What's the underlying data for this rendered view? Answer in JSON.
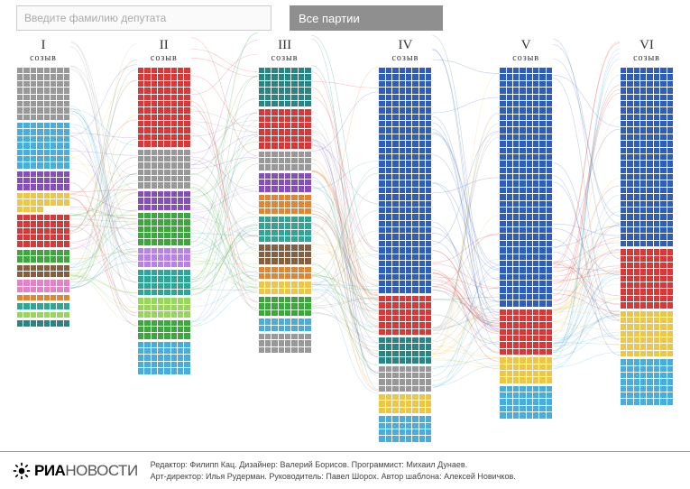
{
  "ui": {
    "search_placeholder": "Введите фамилию депутата",
    "party_button": "Все партии"
  },
  "footer": {
    "logo_bold": "РИА",
    "logo_light": "НОВОСТИ",
    "credits_line1": "Редактор: Филипп Кац. Дизайнер: Валерий Борисов. Программист: Михаил Дунаев.",
    "credits_line2": "Арт-директор: Илья Рудерман. Руководитель: Павел Шорох. Автор шаблона: Алексей Новичков."
  },
  "chart_data": {
    "type": "sankey",
    "title": "",
    "column_label": "созыв",
    "columns": [
      "I",
      "II",
      "III",
      "IV",
      "V",
      "VI"
    ],
    "palette": {
      "er": "#1f4fb4",
      "kprf": "#d62728",
      "ldpr": "#3aa6d8",
      "sr": "#e9c23a",
      "gray": "#8f8f8f",
      "teal": "#1f9d8c",
      "green": "#2ca02c",
      "purple": "#7b3fb3",
      "orange": "#e07b1f",
      "brown": "#7a5230",
      "pink": "#e377c2",
      "dteal": "#177a7a",
      "lime": "#8fd14f",
      "violet": "#b07ae0"
    },
    "series": [
      {
        "name": "I",
        "blocks": [
          {
            "party": "gray",
            "seats": 64
          },
          {
            "party": "ldpr",
            "seats": 56
          },
          {
            "party": "purple",
            "seats": 24
          },
          {
            "party": "sr",
            "seats": 20
          },
          {
            "party": "kprf",
            "seats": 40
          },
          {
            "party": "green",
            "seats": 16
          },
          {
            "party": "brown",
            "seats": 16
          },
          {
            "party": "pink",
            "seats": 16
          },
          {
            "party": "orange",
            "seats": 8
          },
          {
            "party": "teal",
            "seats": 8
          },
          {
            "party": "lime",
            "seats": 8
          },
          {
            "party": "dteal",
            "seats": 8
          }
        ]
      },
      {
        "name": "II",
        "blocks": [
          {
            "party": "kprf",
            "seats": 96
          },
          {
            "party": "gray",
            "seats": 48
          },
          {
            "party": "purple",
            "seats": 24
          },
          {
            "party": "green",
            "seats": 40
          },
          {
            "party": "violet",
            "seats": 24
          },
          {
            "party": "teal",
            "seats": 32
          },
          {
            "party": "lime",
            "seats": 24
          },
          {
            "party": "green",
            "seats": 24
          },
          {
            "party": "ldpr",
            "seats": 40
          }
        ]
      },
      {
        "name": "III",
        "blocks": [
          {
            "party": "dteal",
            "seats": 48
          },
          {
            "party": "kprf",
            "seats": 48
          },
          {
            "party": "gray",
            "seats": 24
          },
          {
            "party": "purple",
            "seats": 24
          },
          {
            "party": "orange",
            "seats": 24
          },
          {
            "party": "teal",
            "seats": 32
          },
          {
            "party": "brown",
            "seats": 24
          },
          {
            "party": "orange",
            "seats": 16
          },
          {
            "party": "sr",
            "seats": 16
          },
          {
            "party": "green",
            "seats": 24
          },
          {
            "party": "ldpr",
            "seats": 16
          },
          {
            "party": "gray",
            "seats": 24
          }
        ]
      },
      {
        "name": "IV",
        "blocks": [
          {
            "party": "er",
            "seats": 272
          },
          {
            "party": "kprf",
            "seats": 48
          },
          {
            "party": "dteal",
            "seats": 32
          },
          {
            "party": "gray",
            "seats": 32
          },
          {
            "party": "sr",
            "seats": 24
          },
          {
            "party": "ldpr",
            "seats": 32
          }
        ]
      },
      {
        "name": "V",
        "blocks": [
          {
            "party": "er",
            "seats": 288
          },
          {
            "party": "kprf",
            "seats": 56
          },
          {
            "party": "sr",
            "seats": 32
          },
          {
            "party": "ldpr",
            "seats": 40
          }
        ]
      },
      {
        "name": "VI",
        "blocks": [
          {
            "party": "er",
            "seats": 216
          },
          {
            "party": "kprf",
            "seats": 72
          },
          {
            "party": "sr",
            "seats": 56
          },
          {
            "party": "ldpr",
            "seats": 56
          }
        ]
      }
    ],
    "links_note": "Thin curved lines connect the same deputies across convocations; colors follow source party."
  }
}
